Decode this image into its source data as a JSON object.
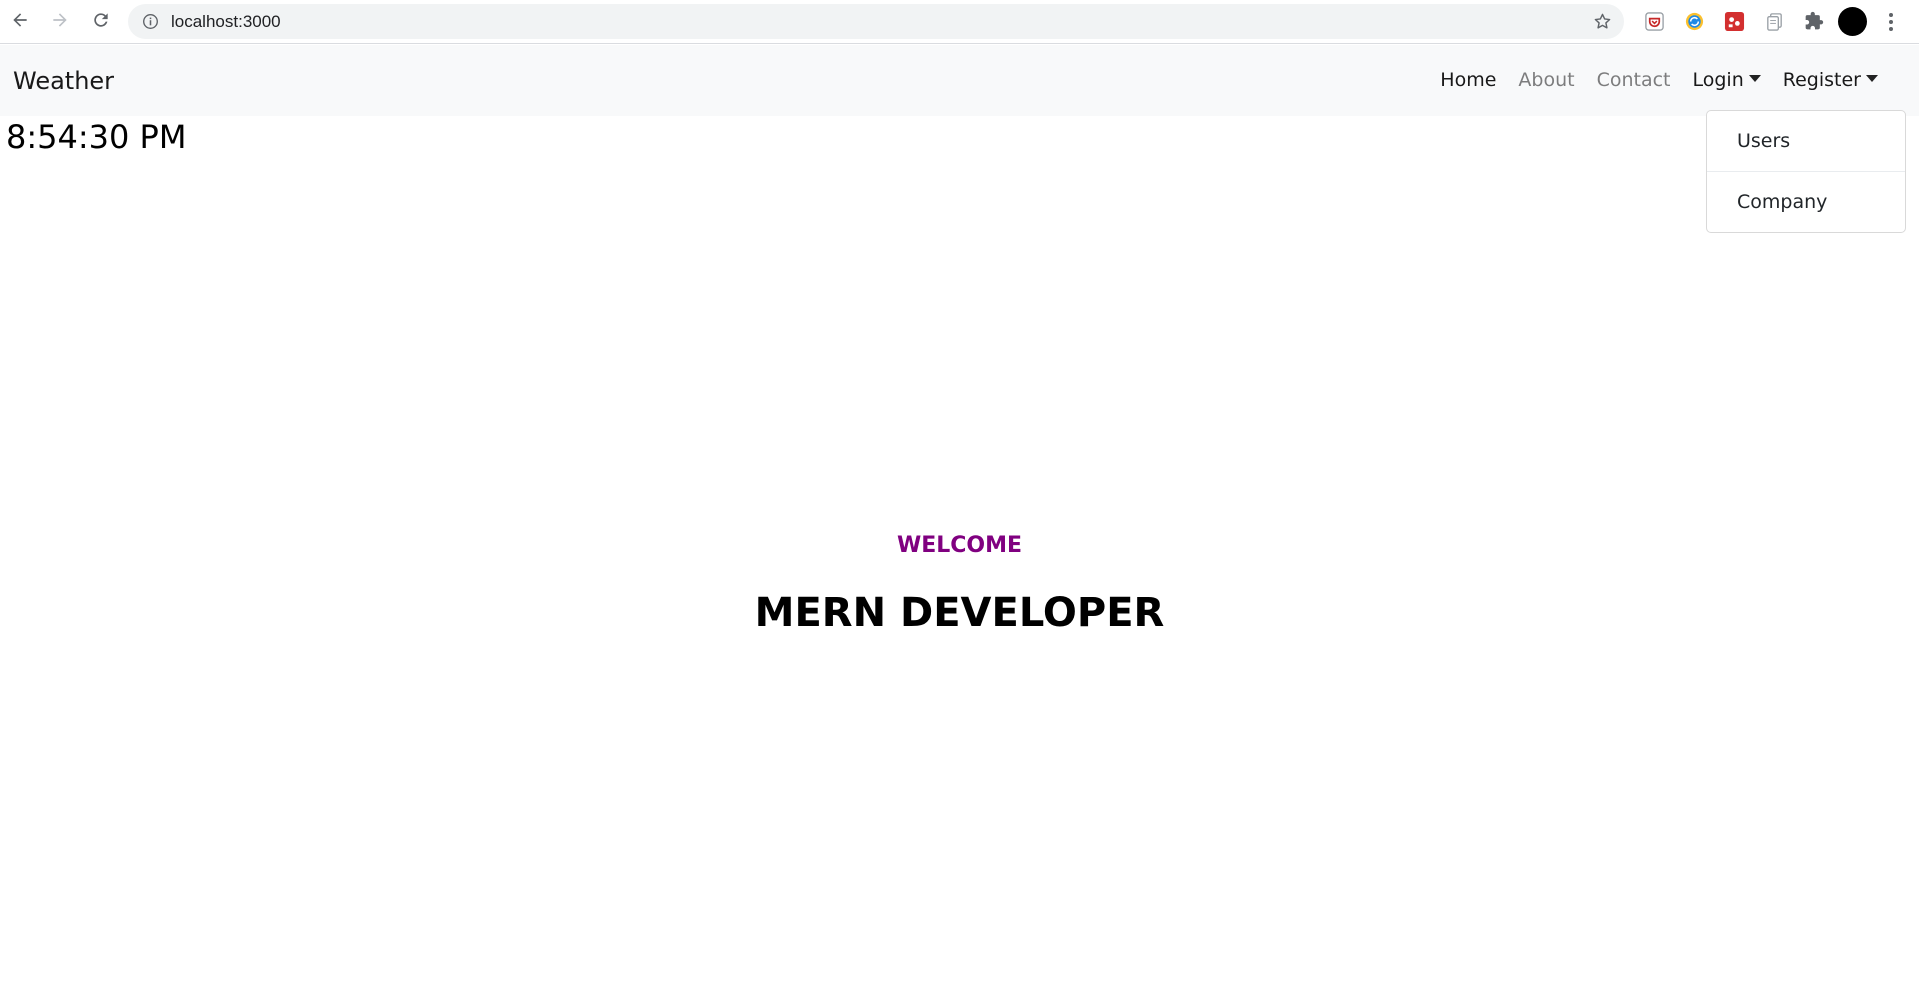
{
  "browser": {
    "url": "localhost:3000"
  },
  "navbar": {
    "brand": "Weather",
    "links": [
      "Home",
      "About",
      "Contact"
    ],
    "login_label": "Login",
    "register_label": "Register"
  },
  "dropdown": {
    "items": [
      "Users",
      "Company"
    ]
  },
  "clock": "8:54:30 PM",
  "hero": {
    "welcome": "WELCOME",
    "headline": "MERN DEVELOPER"
  },
  "colors": {
    "welcome": "#800080",
    "navbar_bg": "#f8f9fa"
  }
}
